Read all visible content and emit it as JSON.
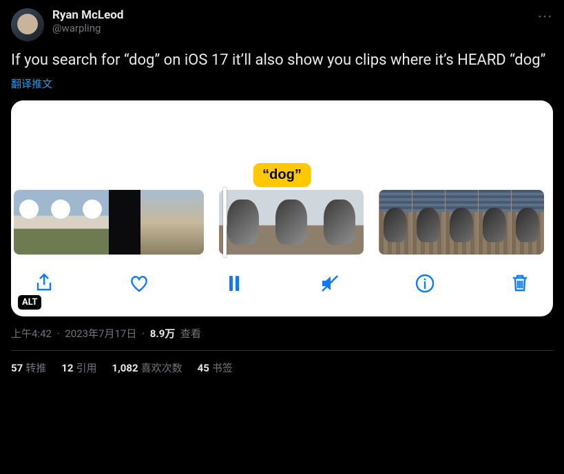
{
  "author": {
    "display_name": "Ryan McLeod",
    "handle": "@warpling"
  },
  "more_label": "···",
  "tweet_text": "If you search for “dog” on iOS 17 it’ll also show you clips where it’s HEARD “dog”",
  "translate_label": "翻译推文",
  "media": {
    "highlight_word": "“dog”",
    "alt_badge": "ALT",
    "controls": {
      "share": "share",
      "like": "like",
      "pause": "pause",
      "mute": "mute",
      "info": "info",
      "delete": "delete"
    }
  },
  "meta": {
    "time": "上午4:42",
    "date": "2023年7月17日",
    "views_count": "8.9万",
    "views_label": "查看"
  },
  "stats": {
    "retweets": {
      "count": "57",
      "label": "转推"
    },
    "quotes": {
      "count": "12",
      "label": "引用"
    },
    "likes": {
      "count": "1,082",
      "label": "喜欢次数"
    },
    "bookmarks": {
      "count": "45",
      "label": "书签"
    }
  }
}
